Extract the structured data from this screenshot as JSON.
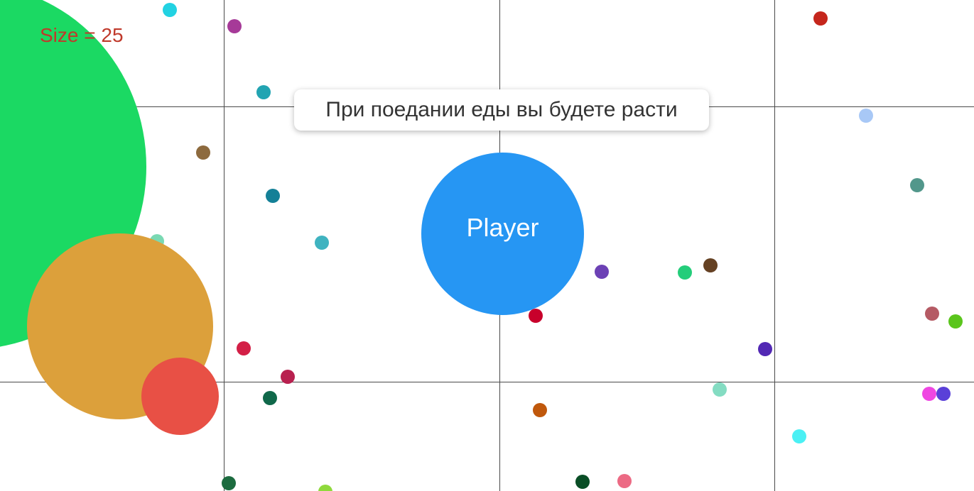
{
  "hud": {
    "size_label": "Size = 25"
  },
  "tooltip": {
    "text": "При поедании еды вы будете расти"
  },
  "player": {
    "name": "Player",
    "color": "#2696f3"
  },
  "colors": {
    "grid": "#4a4a4a",
    "enemy_green": "#1bd963",
    "enemy_orange": "#dca03b",
    "enemy_red": "#e85045",
    "size_label": "#c0392b"
  },
  "food_colors": [
    "#22d2e2",
    "#a63a98",
    "#c5261c",
    "#22a4b2",
    "#a8c8f6",
    "#8d6a3e",
    "#148097",
    "#52978b",
    "#3fb3c0",
    "#6c41b5",
    "#24cd7a",
    "#654123",
    "#c8002b",
    "#b55a64",
    "#5ac51c",
    "#d31f46",
    "#5228b4",
    "#b8204f",
    "#10684a",
    "#84dcc2",
    "#c0580c",
    "#ef47e2",
    "#5a40d8",
    "#4bf0f4",
    "#1c6b3f",
    "#0a4e26",
    "#ec6a84",
    "#8fd93c",
    "#7ad9b3"
  ]
}
